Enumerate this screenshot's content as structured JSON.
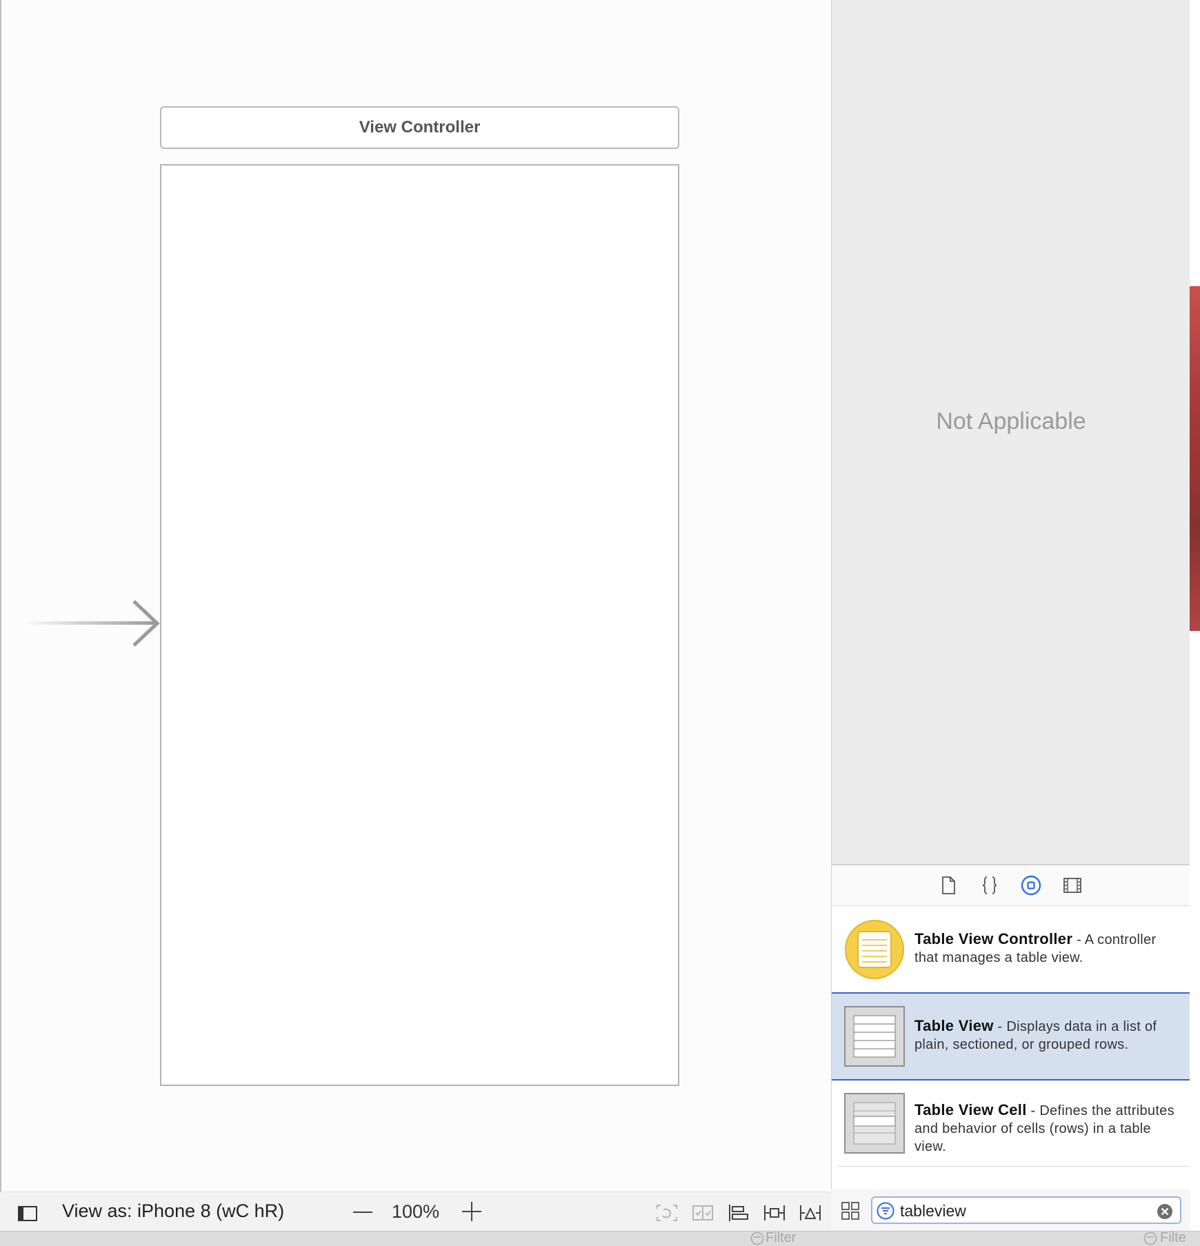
{
  "canvas": {
    "scene_title": "View Controller",
    "view_as_label": "View as: iPhone 8 (wC hR)",
    "zoom_level": "100%"
  },
  "inspector": {
    "empty_state": "Not Applicable"
  },
  "library": {
    "tabs": [
      "file-template-icon",
      "code-snippet-icon",
      "object-library-icon",
      "media-library-icon"
    ],
    "items": [
      {
        "title": "Table View Controller",
        "description": " - A controller that manages a table view."
      },
      {
        "title": "Table View",
        "description": " - Displays data in a list of plain, sectioned, or grouped rows."
      },
      {
        "title": "Table View Cell",
        "description": " - Defines the attributes and behavior of cells (rows) in a table view."
      }
    ],
    "search_value": "tableview"
  },
  "lower_strip": {
    "filter_label": "Filter",
    "filter_label_2": "Filte"
  },
  "colors": {
    "selected_row": "#d5e0ef",
    "selected_border": "#3a64b8",
    "accent_blue": "#2f6fe0",
    "controller_yellow": "#f5cf4a"
  }
}
